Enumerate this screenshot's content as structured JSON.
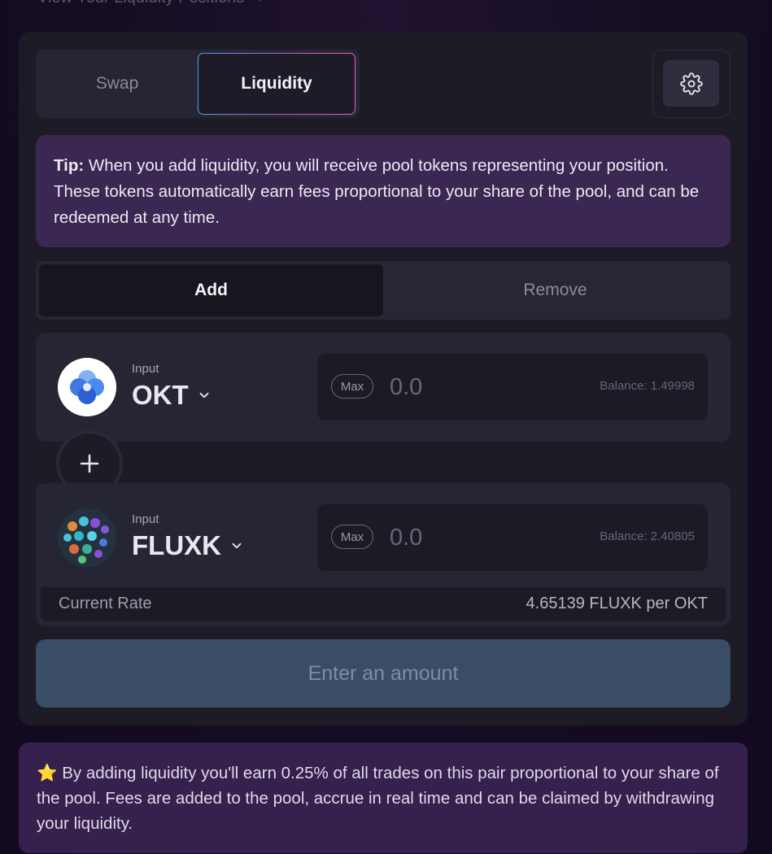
{
  "header": {
    "view_positions_link": "View Your Liquidity Positions →"
  },
  "tabs": {
    "swap": "Swap",
    "liquidity": "Liquidity",
    "active": "Liquidity"
  },
  "tip": {
    "bold": "Tip:",
    "text": " When you add liquidity, you will receive pool tokens representing your position. These tokens automatically earn fees proportional to your share of the pool, and can be redeemed at any time."
  },
  "mode": {
    "add": "Add",
    "remove": "Remove",
    "active": "Add"
  },
  "token_a": {
    "label": "Input",
    "symbol": "OKT",
    "max_label": "Max",
    "placeholder": "0.0",
    "balance": "Balance: 1.49998",
    "icon": "okt-logo-icon"
  },
  "token_b": {
    "label": "Input",
    "symbol": "FLUXK",
    "max_label": "Max",
    "placeholder": "0.0",
    "balance": "Balance: 2.40805",
    "icon": "fluxk-logo-icon"
  },
  "rate": {
    "label": "Current Rate",
    "value": "4.65139 FLUXK per OKT"
  },
  "submit": {
    "label": "Enter an amount"
  },
  "info": {
    "star": "⭐",
    "text": " By adding liquidity you'll earn 0.25% of all trades on this pair proportional to your share of the pool. Fees are added to the pool, accrue in real time and can be claimed by withdrawing your liquidity."
  },
  "colors": {
    "background": "#150c22",
    "card": "#1c1b26",
    "tip_bg": "#3a2752",
    "button_disabled": "#394d66",
    "accent_gradient": [
      "#4aa3e8",
      "#e65ec0"
    ]
  }
}
